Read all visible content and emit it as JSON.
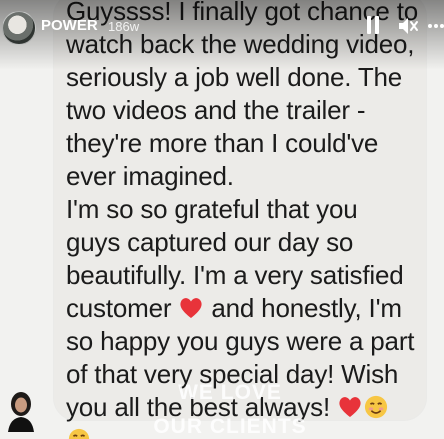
{
  "header": {
    "page_name": "POWER",
    "age": "186w",
    "icons": [
      "pause-icon",
      "mute-icon",
      "more-icon"
    ]
  },
  "message": {
    "lines_1": "Guyssss! I finally got chance to\nwatch back the wedding video,\nseriously a job well done. The\ntwo videos and the trailer -\nthey're more than I could've\never imagined.",
    "lines_2": "I'm so so grateful that you\nguys captured our day so\nbeautifully. I'm a very satisfied\ncustomer",
    "lines_3": " and honestly, I'm\nso happy you guys were a part\nof that very special day! Wish\nyou all the best always! ",
    "emojis": [
      "red-heart-emoji",
      "red-heart-emoji",
      "smiling-face-emoji",
      "hugging-face-emoji"
    ]
  },
  "watermark": {
    "line1": "WE LOVE",
    "line2": "OUR CLIENTS"
  }
}
